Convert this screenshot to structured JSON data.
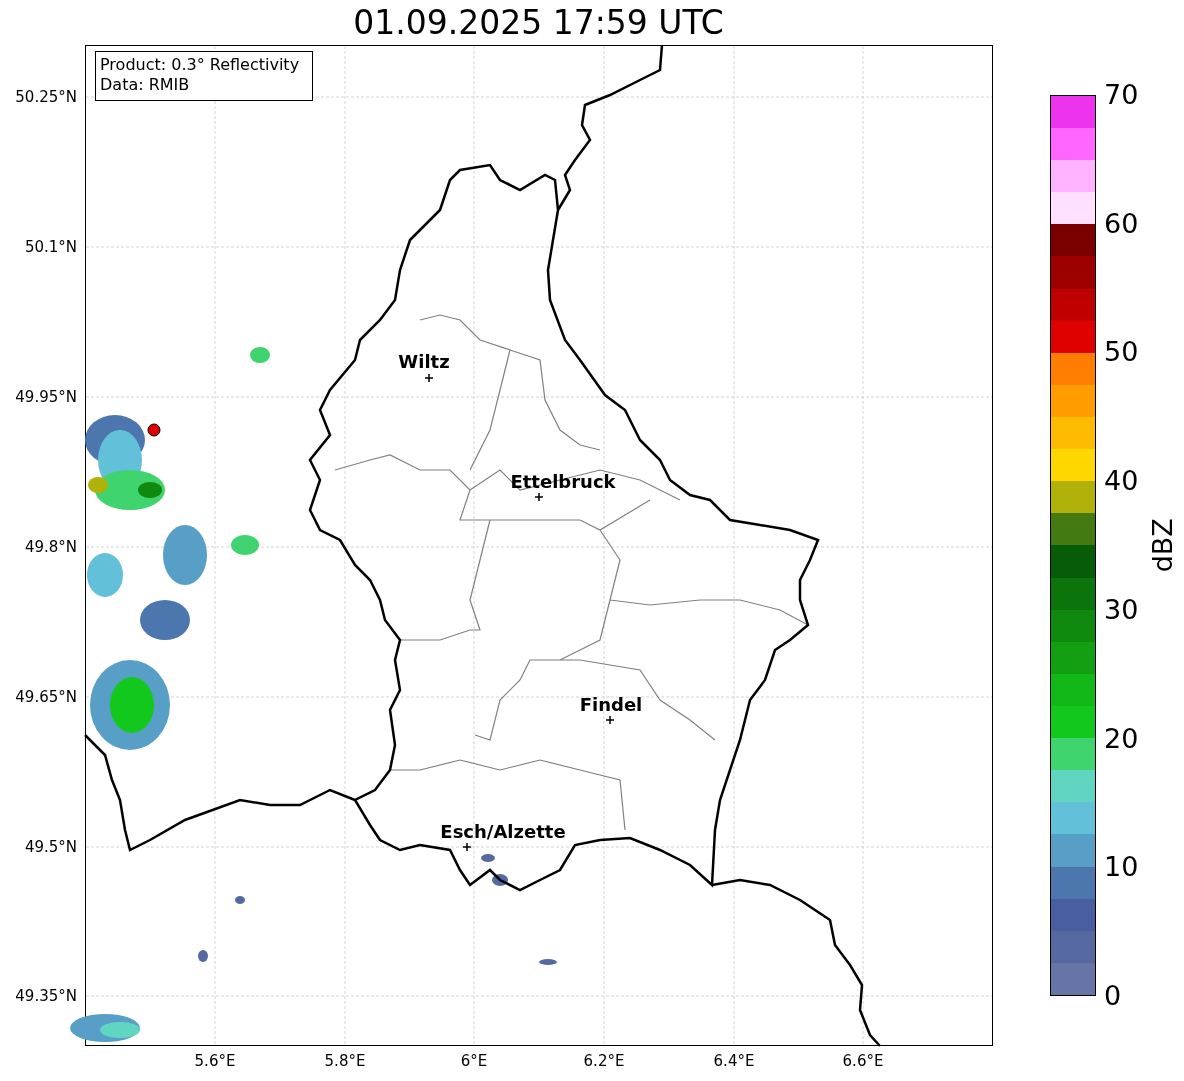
{
  "title": "01.09.2025 17:59 UTC",
  "info_box": [
    "Product: 0.3° Reflectivity",
    "Data: RMIB"
  ],
  "map": {
    "lat_ticks": [
      "50.25°N",
      "50.1°N",
      "49.95°N",
      "49.8°N",
      "49.65°N",
      "49.5°N",
      "49.35°N"
    ],
    "lon_ticks": [
      "5.6°E",
      "5.8°E",
      "6°E",
      "6.2°E",
      "6.4°E",
      "6.6°E"
    ],
    "cities": [
      {
        "name": "Wiltz"
      },
      {
        "name": "Ettelbruck"
      },
      {
        "name": "Findel"
      },
      {
        "name": "Esch/Alzette"
      }
    ]
  },
  "colorbar": {
    "label": "dBZ",
    "ticks": [
      "70",
      "60",
      "50",
      "40",
      "30",
      "20",
      "10",
      "0"
    ],
    "bins": [
      {
        "color": "#6675a6"
      },
      {
        "color": "#55689f"
      },
      {
        "color": "#475fa0"
      },
      {
        "color": "#4b77ae"
      },
      {
        "color": "#589fc7"
      },
      {
        "color": "#62c0d8"
      },
      {
        "color": "#60d6c2"
      },
      {
        "color": "#3fd46d"
      },
      {
        "color": "#13c81d"
      },
      {
        "color": "#12b818"
      },
      {
        "color": "#12a012"
      },
      {
        "color": "#0f8a0f"
      },
      {
        "color": "#0b750b"
      },
      {
        "color": "#075d07"
      },
      {
        "color": "#437a12"
      },
      {
        "color": "#b0b209"
      },
      {
        "color": "#ffd700"
      },
      {
        "color": "#ffbb00"
      },
      {
        "color": "#ff9c00"
      },
      {
        "color": "#ff7d00"
      },
      {
        "color": "#e00000"
      },
      {
        "color": "#c00000"
      },
      {
        "color": "#9e0000"
      },
      {
        "color": "#7a0000"
      },
      {
        "color": "#ffe0ff"
      },
      {
        "color": "#ffb3ff"
      },
      {
        "color": "#ff66ff"
      },
      {
        "color": "#ee33ee"
      }
    ]
  }
}
